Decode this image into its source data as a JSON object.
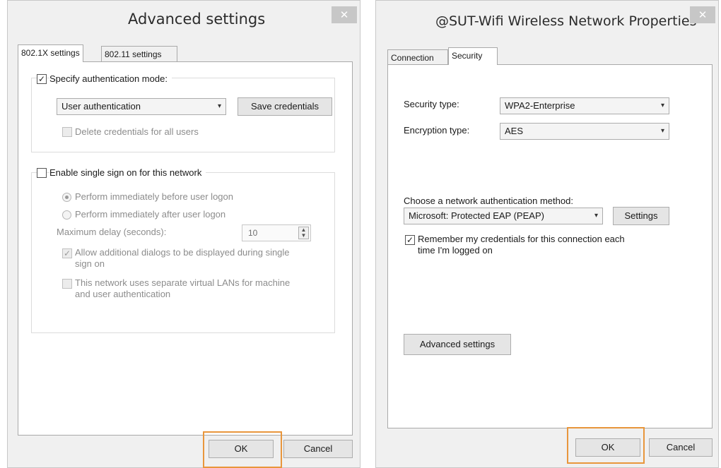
{
  "left_dialog": {
    "title": "Advanced settings",
    "close_glyph": "✕",
    "tabs": [
      "802.1X settings",
      "802.11 settings"
    ],
    "specify_auth": {
      "label": "Specify authentication mode:",
      "checked": true
    },
    "auth_mode_select": "User authentication",
    "save_credentials_label": "Save credentials",
    "delete_credentials_label": "Delete credentials for all users",
    "sso": {
      "label": "Enable single sign on for this network",
      "checked": false
    },
    "radio_before": "Perform immediately before user logon",
    "radio_after": "Perform immediately after user logon",
    "max_delay_label": "Maximum delay (seconds):",
    "max_delay_value": "10",
    "allow_dialogs_label_line1": "Allow additional dialogs to be displayed during single",
    "allow_dialogs_label_line2": "sign on",
    "vlan_label_line1": "This network uses separate virtual LANs for machine",
    "vlan_label_line2": "and user authentication",
    "ok_label": "OK",
    "cancel_label": "Cancel"
  },
  "right_dialog": {
    "title": "@SUT-Wifi Wireless Network Properties",
    "close_glyph": "✕",
    "tabs": [
      "Connection",
      "Security"
    ],
    "security_type_label": "Security type:",
    "security_type_value": "WPA2-Enterprise",
    "encryption_type_label": "Encryption type:",
    "encryption_type_value": "AES",
    "auth_method_label": "Choose a network authentication method:",
    "auth_method_value": "Microsoft: Protected EAP (PEAP)",
    "settings_label": "Settings",
    "remember_label_line1": "Remember my credentials for this connection each",
    "remember_label_line2": "time I'm logged on",
    "remember_checked": true,
    "advanced_settings_label": "Advanced settings",
    "ok_label": "OK",
    "cancel_label": "Cancel"
  },
  "glyphs": {
    "check": "✓",
    "chevron": "▾",
    "spin_up": "▲",
    "spin_down": "▼"
  },
  "colors": {
    "highlight": "#e8963c",
    "window_bg": "#f0f0f0",
    "close_bg": "#c7c7c7"
  }
}
